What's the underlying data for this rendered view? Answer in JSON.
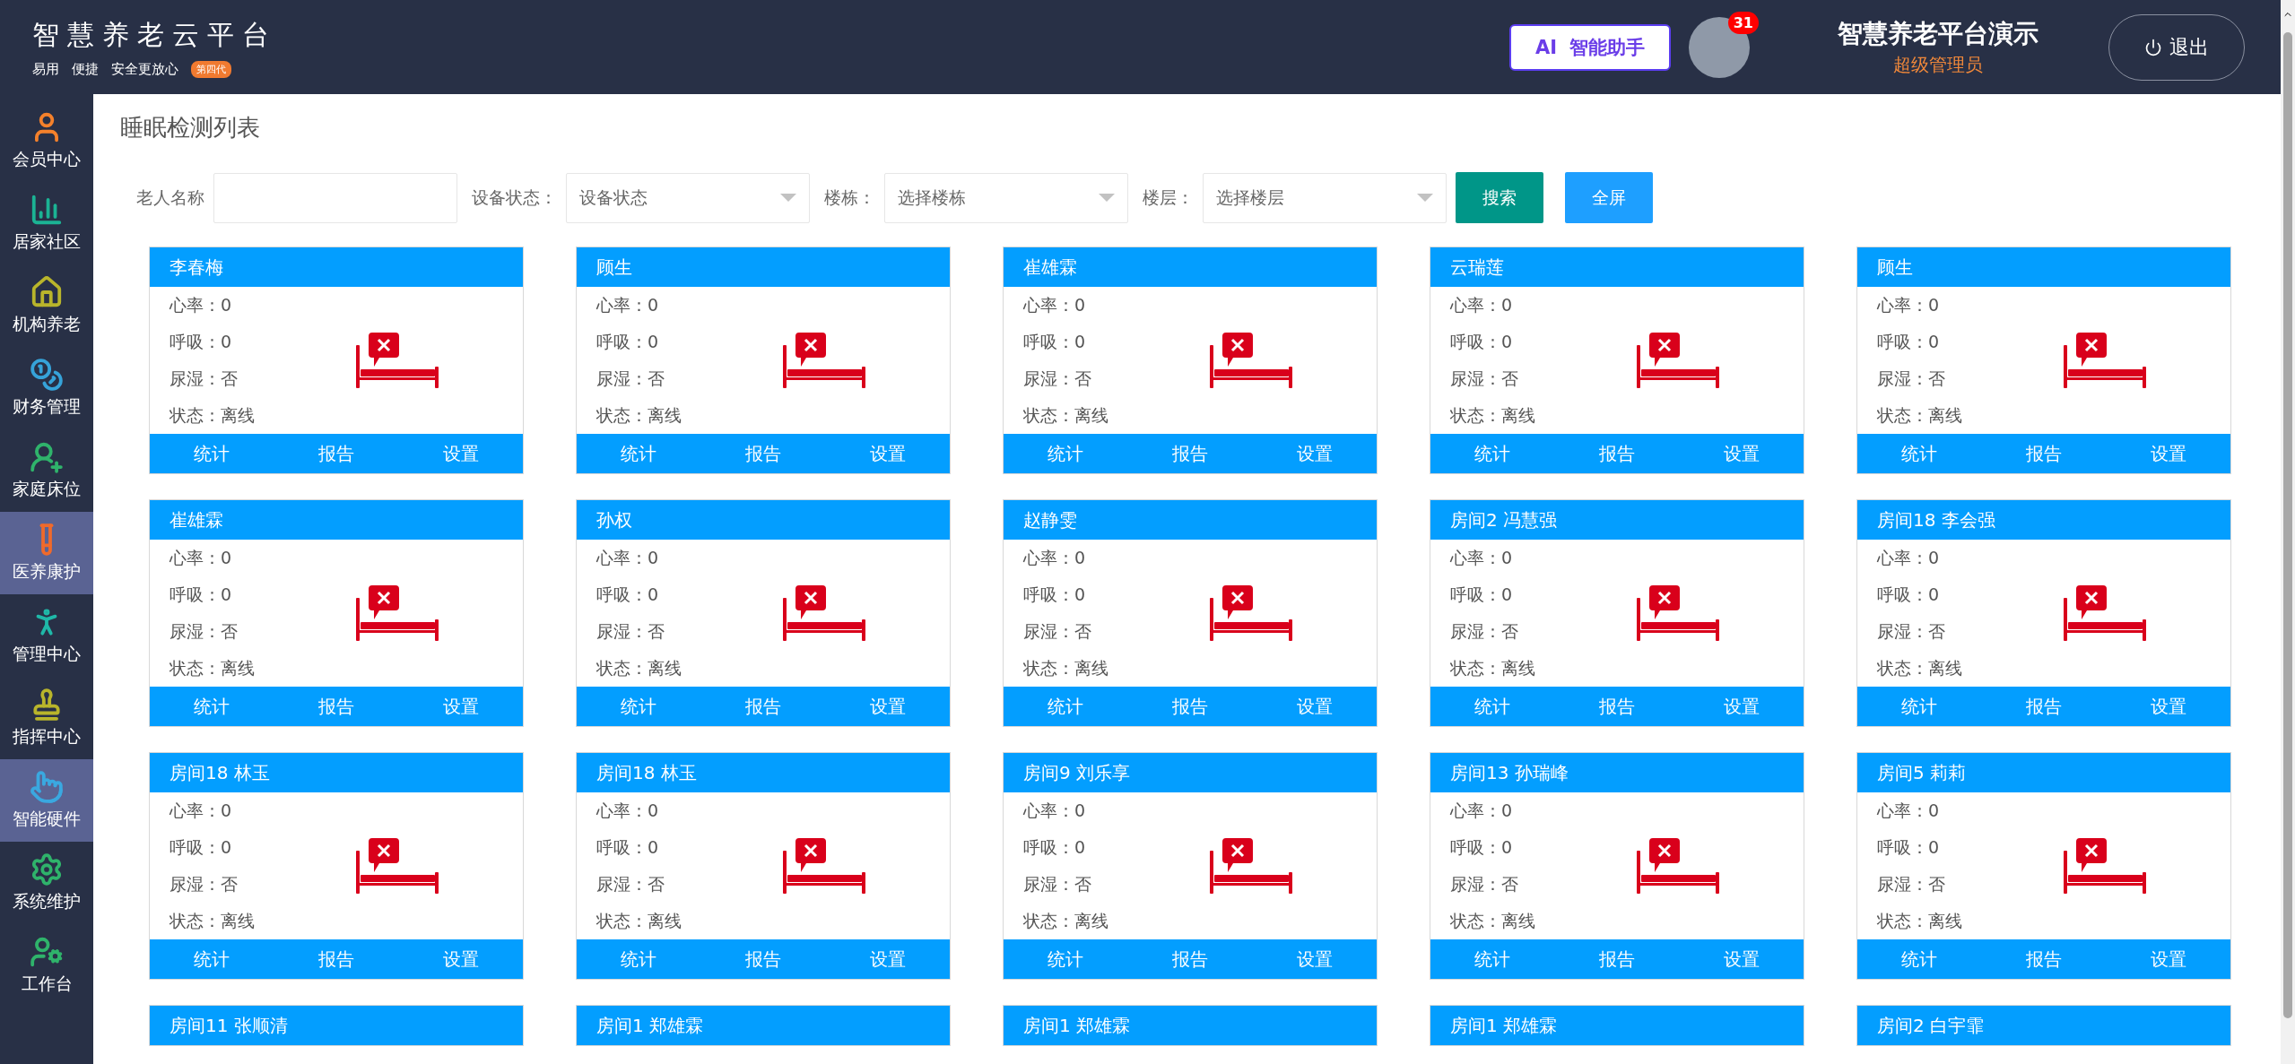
{
  "header": {
    "logo": "智慧养老云平台",
    "slogans": [
      "易用",
      "便捷",
      "安全更放心"
    ],
    "generation_badge": "第四代",
    "ai_button": {
      "prefix": "AI",
      "label": "智能助手"
    },
    "notification_count": "31",
    "user_name": "智慧养老平台演示",
    "user_role": "超级管理员",
    "logout": "退出"
  },
  "sidebar": {
    "items": [
      {
        "label": "会员中心",
        "selected": false
      },
      {
        "label": "居家社区",
        "selected": false
      },
      {
        "label": "机构养老",
        "selected": false
      },
      {
        "label": "财务管理",
        "selected": false
      },
      {
        "label": "家庭床位",
        "selected": false
      },
      {
        "label": "医养康护",
        "selected": true
      },
      {
        "label": "管理中心",
        "selected": false
      },
      {
        "label": "指挥中心",
        "selected": false
      },
      {
        "label": "智能硬件",
        "selected": true
      },
      {
        "label": "系统维护",
        "selected": false
      },
      {
        "label": "工作台",
        "selected": false
      }
    ]
  },
  "page_title": "睡眠检测列表",
  "filters": {
    "name_label": "老人名称",
    "status_label": "设备状态：",
    "status_placeholder": "设备状态",
    "building_label": "楼栋：",
    "building_placeholder": "选择楼栋",
    "floor_label": "楼层：",
    "floor_placeholder": "选择楼层",
    "buttons": [
      "搜索",
      "全屏"
    ]
  },
  "cards": [
    {
      "name": "李春梅",
      "fields": [
        {
          "label": "心率：",
          "value": "0"
        },
        {
          "label": "呼吸：",
          "value": "0"
        },
        {
          "label": "尿湿：",
          "value": "否"
        },
        {
          "label": "状态：",
          "value": "离线"
        }
      ],
      "actions": [
        "统计",
        "报告",
        "设置"
      ]
    },
    {
      "name": "顾生",
      "fields": [
        {
          "label": "心率：",
          "value": "0"
        },
        {
          "label": "呼吸：",
          "value": "0"
        },
        {
          "label": "尿湿：",
          "value": "否"
        },
        {
          "label": "状态：",
          "value": "离线"
        }
      ],
      "actions": [
        "统计",
        "报告",
        "设置"
      ]
    },
    {
      "name": "崔雄霖",
      "fields": [
        {
          "label": "心率：",
          "value": "0"
        },
        {
          "label": "呼吸：",
          "value": "0"
        },
        {
          "label": "尿湿：",
          "value": "否"
        },
        {
          "label": "状态：",
          "value": "离线"
        }
      ],
      "actions": [
        "统计",
        "报告",
        "设置"
      ]
    },
    {
      "name": "云瑞莲",
      "fields": [
        {
          "label": "心率：",
          "value": "0"
        },
        {
          "label": "呼吸：",
          "value": "0"
        },
        {
          "label": "尿湿：",
          "value": "否"
        },
        {
          "label": "状态：",
          "value": "离线"
        }
      ],
      "actions": [
        "统计",
        "报告",
        "设置"
      ]
    },
    {
      "name": "顾生",
      "fields": [
        {
          "label": "心率：",
          "value": "0"
        },
        {
          "label": "呼吸：",
          "value": "0"
        },
        {
          "label": "尿湿：",
          "value": "否"
        },
        {
          "label": "状态：",
          "value": "离线"
        }
      ],
      "actions": [
        "统计",
        "报告",
        "设置"
      ]
    },
    {
      "name": "崔雄霖",
      "fields": [
        {
          "label": "心率：",
          "value": "0"
        },
        {
          "label": "呼吸：",
          "value": "0"
        },
        {
          "label": "尿湿：",
          "value": "否"
        },
        {
          "label": "状态：",
          "value": "离线"
        }
      ],
      "actions": [
        "统计",
        "报告",
        "设置"
      ]
    },
    {
      "name": "孙权",
      "fields": [
        {
          "label": "心率：",
          "value": "0"
        },
        {
          "label": "呼吸：",
          "value": "0"
        },
        {
          "label": "尿湿：",
          "value": "否"
        },
        {
          "label": "状态：",
          "value": "离线"
        }
      ],
      "actions": [
        "统计",
        "报告",
        "设置"
      ]
    },
    {
      "name": "赵静雯",
      "fields": [
        {
          "label": "心率：",
          "value": "0"
        },
        {
          "label": "呼吸：",
          "value": "0"
        },
        {
          "label": "尿湿：",
          "value": "否"
        },
        {
          "label": "状态：",
          "value": "离线"
        }
      ],
      "actions": [
        "统计",
        "报告",
        "设置"
      ]
    },
    {
      "name": "房间2 冯慧强",
      "fields": [
        {
          "label": "心率：",
          "value": "0"
        },
        {
          "label": "呼吸：",
          "value": "0"
        },
        {
          "label": "尿湿：",
          "value": "否"
        },
        {
          "label": "状态：",
          "value": "离线"
        }
      ],
      "actions": [
        "统计",
        "报告",
        "设置"
      ]
    },
    {
      "name": "房间18 李会强",
      "fields": [
        {
          "label": "心率：",
          "value": "0"
        },
        {
          "label": "呼吸：",
          "value": "0"
        },
        {
          "label": "尿湿：",
          "value": "否"
        },
        {
          "label": "状态：",
          "value": "离线"
        }
      ],
      "actions": [
        "统计",
        "报告",
        "设置"
      ]
    },
    {
      "name": "房间18 林玉",
      "fields": [
        {
          "label": "心率：",
          "value": "0"
        },
        {
          "label": "呼吸：",
          "value": "0"
        },
        {
          "label": "尿湿：",
          "value": "否"
        },
        {
          "label": "状态：",
          "value": "离线"
        }
      ],
      "actions": [
        "统计",
        "报告",
        "设置"
      ]
    },
    {
      "name": "房间18 林玉",
      "fields": [
        {
          "label": "心率：",
          "value": "0"
        },
        {
          "label": "呼吸：",
          "value": "0"
        },
        {
          "label": "尿湿：",
          "value": "否"
        },
        {
          "label": "状态：",
          "value": "离线"
        }
      ],
      "actions": [
        "统计",
        "报告",
        "设置"
      ]
    },
    {
      "name": "房间9 刘乐享",
      "fields": [
        {
          "label": "心率：",
          "value": "0"
        },
        {
          "label": "呼吸：",
          "value": "0"
        },
        {
          "label": "尿湿：",
          "value": "否"
        },
        {
          "label": "状态：",
          "value": "离线"
        }
      ],
      "actions": [
        "统计",
        "报告",
        "设置"
      ]
    },
    {
      "name": "房间13 孙瑞峰",
      "fields": [
        {
          "label": "心率：",
          "value": "0"
        },
        {
          "label": "呼吸：",
          "value": "0"
        },
        {
          "label": "尿湿：",
          "value": "否"
        },
        {
          "label": "状态：",
          "value": "离线"
        }
      ],
      "actions": [
        "统计",
        "报告",
        "设置"
      ]
    },
    {
      "name": "房间5 莉莉",
      "fields": [
        {
          "label": "心率：",
          "value": "0"
        },
        {
          "label": "呼吸：",
          "value": "0"
        },
        {
          "label": "尿湿：",
          "value": "否"
        },
        {
          "label": "状态：",
          "value": "离线"
        }
      ],
      "actions": [
        "统计",
        "报告",
        "设置"
      ]
    },
    {
      "name": "房间11 张顺清"
    },
    {
      "name": "房间1 郑雄霖"
    },
    {
      "name": "房间1 郑雄霖"
    },
    {
      "name": "房间1 郑雄霖"
    },
    {
      "name": "房间2 白宇霏"
    }
  ]
}
